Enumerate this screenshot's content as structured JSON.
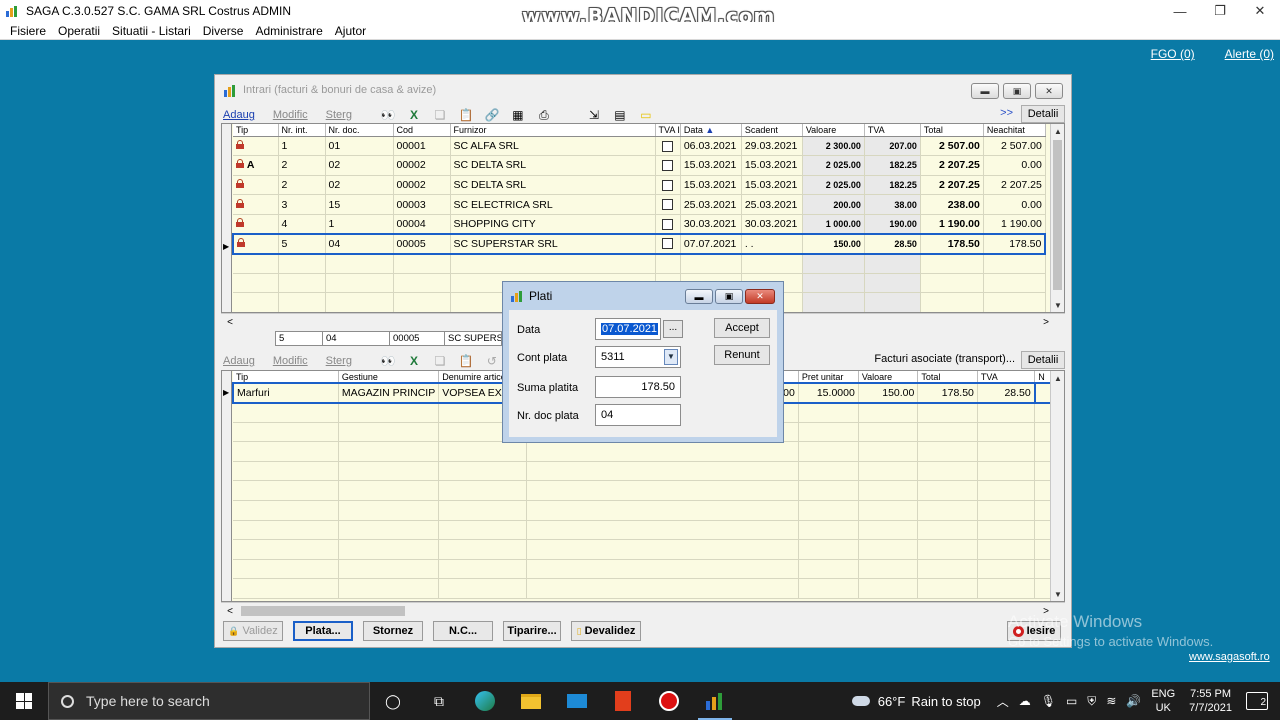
{
  "app": {
    "title": "SAGA C.3.0.527  S.C. GAMA SRL Costrus  ADMIN",
    "watermark": "www.BANDICAM.com"
  },
  "menu": [
    "Fisiere",
    "Operatii",
    "Situatii - Listari",
    "Diverse",
    "Administrare",
    "Ajutor"
  ],
  "top_links": {
    "fgo": "FGO (0)",
    "alerte": "Alerte (0)"
  },
  "footer": {
    "website": "www.sagasoft.ro",
    "activate_title": "Activate Windows",
    "activate_sub": "Go to Settings to activate Windows."
  },
  "main_window": {
    "title": "Intrari (facturi & bonuri de casa & avize)",
    "toolbar": {
      "add": "Adaug",
      "modify": "Modific",
      "delete": "Sterg",
      "more": ">>",
      "details": "Detalii"
    },
    "invoice_columns": [
      "Tip",
      "Nr. int.",
      "Nr. doc.",
      "Cod",
      "Furnizor",
      "TVA I",
      "Data",
      "Scadent",
      "Valoare",
      "TVA",
      "Total",
      "Neachitat"
    ],
    "sort_indicator": "▲",
    "invoices": [
      {
        "tip": "",
        "nr_int": "1",
        "nr_doc": "01",
        "cod": "00001",
        "furnizor": "SC ALFA SRL",
        "data": "06.03.2021",
        "scadent": "29.03.2021",
        "valoare": "2 300.00",
        "tva": "207.00",
        "total": "2 507.00",
        "neachitat": "2 507.00"
      },
      {
        "tip": "A",
        "nr_int": "2",
        "nr_doc": "02",
        "cod": "00002",
        "furnizor": "SC DELTA SRL",
        "data": "15.03.2021",
        "scadent": "15.03.2021",
        "valoare": "2 025.00",
        "tva": "182.25",
        "total": "2 207.25",
        "neachitat": "0.00"
      },
      {
        "tip": "",
        "nr_int": "2",
        "nr_doc": "02",
        "cod": "00002",
        "furnizor": "SC DELTA SRL",
        "data": "15.03.2021",
        "scadent": "15.03.2021",
        "valoare": "2 025.00",
        "tva": "182.25",
        "total": "2 207.25",
        "neachitat": "2 207.25"
      },
      {
        "tip": "",
        "nr_int": "3",
        "nr_doc": "15",
        "cod": "00003",
        "furnizor": "SC ELECTRICA SRL",
        "data": "25.03.2021",
        "scadent": "25.03.2021",
        "valoare": "200.00",
        "tva": "38.00",
        "total": "238.00",
        "neachitat": "0.00"
      },
      {
        "tip": "",
        "nr_int": "4",
        "nr_doc": "1",
        "cod": "00004",
        "furnizor": "SHOPPING CITY",
        "data": "30.03.2021",
        "scadent": "30.03.2021",
        "valoare": "1 000.00",
        "tva": "190.00",
        "total": "1 190.00",
        "neachitat": "1 190.00"
      },
      {
        "tip": "",
        "nr_int": "5",
        "nr_doc": "04",
        "cod": "00005",
        "furnizor": "SC SUPERSTAR SRL",
        "data": "07.07.2021",
        "scadent": ". .",
        "valoare": "150.00",
        "tva": "28.50",
        "total": "178.50",
        "neachitat": "178.50"
      }
    ],
    "detail_fields": [
      "5",
      "04",
      "00005",
      "SC SUPERST"
    ],
    "lines_toolbar": {
      "add": "Adaug",
      "modify": "Modific",
      "delete": "Sterg",
      "associated": "Facturi asociate (transport)...",
      "details": "Detalii"
    },
    "line_columns": [
      "Tip",
      "Gestiune",
      "Denumire articol / s",
      "Pret unitar",
      "Valoare",
      "Total",
      "TVA",
      "N"
    ],
    "lines": [
      {
        "tip": "Marfuri",
        "gestiune": "MAGAZIN PRINCIP",
        "denumire": "VOPSEA EXTER",
        "cant_tail": "00",
        "pret": "15.0000",
        "valoare": "150.00",
        "total": "178.50",
        "tva": "28.50"
      }
    ],
    "bottom_buttons": {
      "validez": "Validez",
      "plata": "Plata...",
      "stornez": "Stornez",
      "nc": "N.C...",
      "tiparire": "Tiparire...",
      "devalidez": "Devalidez",
      "iesire": "Iesire"
    }
  },
  "dialog": {
    "title": "Plati",
    "labels": {
      "data": "Data",
      "cont": "Cont plata",
      "suma": "Suma platita",
      "nr_doc": "Nr. doc plata"
    },
    "values": {
      "data": "07.07.2021",
      "cont": "5311",
      "suma": "178.50",
      "nr_doc": "04"
    },
    "dots": "...",
    "accept": "Accept",
    "renunt": "Renunt"
  },
  "taskbar": {
    "search_placeholder": "Type here to search",
    "weather_temp": "66°F",
    "weather_desc": "Rain to stop",
    "lang": "ENG",
    "region": "UK",
    "time": "7:55 PM",
    "date": "7/7/2021",
    "notifications": "2"
  },
  "colors": {
    "workspace": "#0a7aa6",
    "grid_bg": "#fbfbe2",
    "selection": "#1a5fc8",
    "dialog_frame": "#bfd3ea"
  }
}
